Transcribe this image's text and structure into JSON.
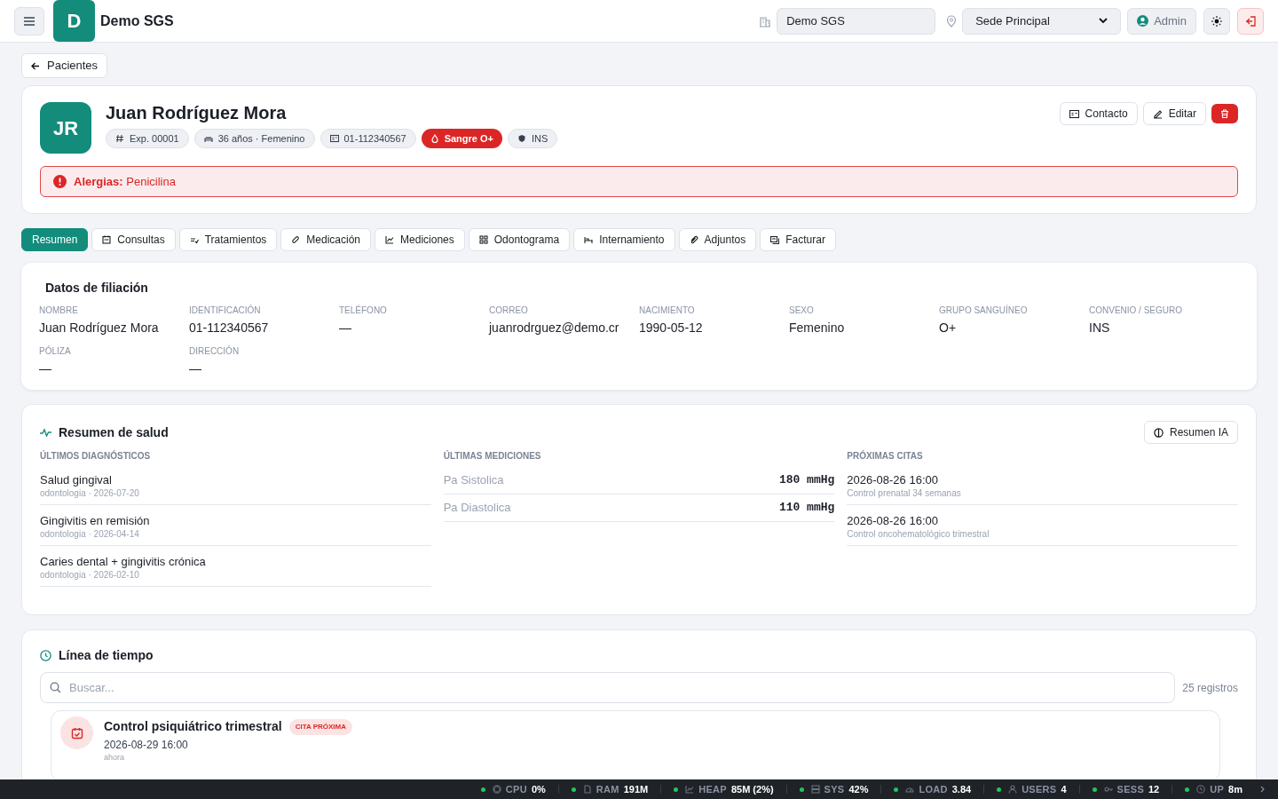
{
  "header": {
    "logo_letter": "D",
    "app_name": "Demo SGS",
    "company_field": {
      "value": "Demo SGS"
    },
    "branch_select": {
      "value": "Sede Principal"
    },
    "user": "Admin"
  },
  "back_link": "Pacientes",
  "patient": {
    "initials": "JR",
    "name": "Juan Rodríguez Mora",
    "chips": [
      {
        "label": "Exp. 00001",
        "kind": "plain"
      },
      {
        "label": "36 años · Femenino",
        "kind": "plain"
      },
      {
        "label": "01-112340567",
        "kind": "plain"
      },
      {
        "label": "Sangre O+",
        "kind": "alert"
      },
      {
        "label": "INS",
        "kind": "plain"
      }
    ],
    "actions": [
      "Contacto",
      "Editar"
    ],
    "allergy": "**Alergias:** Penicilina"
  },
  "tabs": [
    {
      "label": "Resumen",
      "selected": true
    },
    {
      "label": "Consultas",
      "selected": false
    },
    {
      "label": "Tratamientos",
      "selected": false
    },
    {
      "label": "Medicación",
      "selected": false
    },
    {
      "label": "Mediciones",
      "selected": false
    },
    {
      "label": "Odontograma",
      "selected": false
    },
    {
      "label": "Internamiento",
      "selected": false
    },
    {
      "label": "Adjuntos",
      "selected": false
    },
    {
      "label": "Facturar",
      "selected": false
    }
  ],
  "filiation": {
    "title": "Datos de filiación",
    "fields": [
      {
        "label": "NOMBRE",
        "value": "Juan Rodríguez Mora"
      },
      {
        "label": "IDENTIFICACIÓN",
        "value": "01-112340567"
      },
      {
        "label": "TELÉFONO",
        "value": "—"
      },
      {
        "label": "CORREO",
        "value": "juanrodrguez@demo.cr"
      },
      {
        "label": "NACIMIENTO",
        "value": "1990-05-12"
      },
      {
        "label": "SEXO",
        "value": "Femenino"
      },
      {
        "label": "GRUPO SANGUÍNEO",
        "value": "O+"
      },
      {
        "label": "CONVENIO / SEGURO",
        "value": "INS"
      },
      {
        "label": "PÓLIZA",
        "value": "—"
      },
      {
        "label": "DIRECCIÓN",
        "value": "—"
      }
    ]
  },
  "health_summary": {
    "title": "Resumen de salud",
    "ai_button": "Resumen IA",
    "diagnoses": {
      "heading": "ÚLTIMOS DIAGNÓSTICOS",
      "items": [
        {
          "title": "Salud gingival",
          "meta": "odontologia · 2026-07-20"
        },
        {
          "title": "Gingivitis en remisión",
          "meta": "odontologia · 2026-04-14"
        },
        {
          "title": "Caries dental + gingivitis crónica",
          "meta": "odontologia · 2026-02-10"
        }
      ]
    },
    "measurements": {
      "heading": "ÚLTIMAS MEDICIONES",
      "items": [
        {
          "name": "Pa Sistolica",
          "value": "180 mmHg"
        },
        {
          "name": "Pa Diastolica",
          "value": "110 mmHg"
        }
      ]
    },
    "appointments": {
      "heading": "PRÓXIMAS CITAS",
      "items": [
        {
          "datetime": "2026-08-26 16:00",
          "description": "Control prenatal 34 semanas"
        },
        {
          "datetime": "2026-08-26 16:00",
          "description": "Control oncohematológico trimestral"
        }
      ]
    }
  },
  "timeline": {
    "title": "Línea de tiempo",
    "search": {
      "placeholder": "Buscar..."
    },
    "count": "25 registros",
    "entries": [
      {
        "title": "Control psiquiátrico trimestral",
        "badge": "CITA PRÓXIMA",
        "datetime": "2026-08-29 16:00",
        "ago": "ahora"
      }
    ]
  },
  "status_bar": [
    {
      "label": "CPU",
      "value": "0%",
      "color": "#22c55e"
    },
    {
      "label": "RAM",
      "value": "191M",
      "color": "#22c55e"
    },
    {
      "label": "HEAP",
      "value": "85M (2%)",
      "color": "#22c55e"
    },
    {
      "label": "SYS",
      "value": "42%",
      "color": "#22c55e"
    },
    {
      "label": "LOAD",
      "value": "3.84",
      "color": "#22c55e"
    },
    {
      "label": "USERS",
      "value": "4",
      "color": "#22c55e"
    },
    {
      "label": "SESS",
      "value": "12",
      "color": "#22c55e"
    },
    {
      "label": "UP",
      "value": "8m",
      "color": "#22c55e"
    }
  ]
}
